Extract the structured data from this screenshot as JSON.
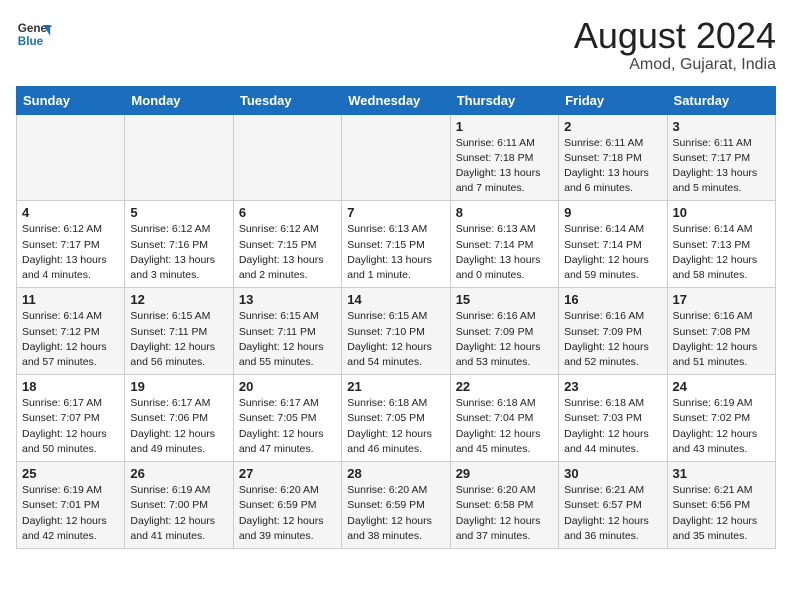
{
  "header": {
    "logo_line1": "General",
    "logo_line2": "Blue",
    "title": "August 2024",
    "subtitle": "Amod, Gujarat, India"
  },
  "days_of_week": [
    "Sunday",
    "Monday",
    "Tuesday",
    "Wednesday",
    "Thursday",
    "Friday",
    "Saturday"
  ],
  "weeks": [
    [
      {
        "num": "",
        "info": ""
      },
      {
        "num": "",
        "info": ""
      },
      {
        "num": "",
        "info": ""
      },
      {
        "num": "",
        "info": ""
      },
      {
        "num": "1",
        "info": "Sunrise: 6:11 AM\nSunset: 7:18 PM\nDaylight: 13 hours\nand 7 minutes."
      },
      {
        "num": "2",
        "info": "Sunrise: 6:11 AM\nSunset: 7:18 PM\nDaylight: 13 hours\nand 6 minutes."
      },
      {
        "num": "3",
        "info": "Sunrise: 6:11 AM\nSunset: 7:17 PM\nDaylight: 13 hours\nand 5 minutes."
      }
    ],
    [
      {
        "num": "4",
        "info": "Sunrise: 6:12 AM\nSunset: 7:17 PM\nDaylight: 13 hours\nand 4 minutes."
      },
      {
        "num": "5",
        "info": "Sunrise: 6:12 AM\nSunset: 7:16 PM\nDaylight: 13 hours\nand 3 minutes."
      },
      {
        "num": "6",
        "info": "Sunrise: 6:12 AM\nSunset: 7:15 PM\nDaylight: 13 hours\nand 2 minutes."
      },
      {
        "num": "7",
        "info": "Sunrise: 6:13 AM\nSunset: 7:15 PM\nDaylight: 13 hours\nand 1 minute."
      },
      {
        "num": "8",
        "info": "Sunrise: 6:13 AM\nSunset: 7:14 PM\nDaylight: 13 hours\nand 0 minutes."
      },
      {
        "num": "9",
        "info": "Sunrise: 6:14 AM\nSunset: 7:14 PM\nDaylight: 12 hours\nand 59 minutes."
      },
      {
        "num": "10",
        "info": "Sunrise: 6:14 AM\nSunset: 7:13 PM\nDaylight: 12 hours\nand 58 minutes."
      }
    ],
    [
      {
        "num": "11",
        "info": "Sunrise: 6:14 AM\nSunset: 7:12 PM\nDaylight: 12 hours\nand 57 minutes."
      },
      {
        "num": "12",
        "info": "Sunrise: 6:15 AM\nSunset: 7:11 PM\nDaylight: 12 hours\nand 56 minutes."
      },
      {
        "num": "13",
        "info": "Sunrise: 6:15 AM\nSunset: 7:11 PM\nDaylight: 12 hours\nand 55 minutes."
      },
      {
        "num": "14",
        "info": "Sunrise: 6:15 AM\nSunset: 7:10 PM\nDaylight: 12 hours\nand 54 minutes."
      },
      {
        "num": "15",
        "info": "Sunrise: 6:16 AM\nSunset: 7:09 PM\nDaylight: 12 hours\nand 53 minutes."
      },
      {
        "num": "16",
        "info": "Sunrise: 6:16 AM\nSunset: 7:09 PM\nDaylight: 12 hours\nand 52 minutes."
      },
      {
        "num": "17",
        "info": "Sunrise: 6:16 AM\nSunset: 7:08 PM\nDaylight: 12 hours\nand 51 minutes."
      }
    ],
    [
      {
        "num": "18",
        "info": "Sunrise: 6:17 AM\nSunset: 7:07 PM\nDaylight: 12 hours\nand 50 minutes."
      },
      {
        "num": "19",
        "info": "Sunrise: 6:17 AM\nSunset: 7:06 PM\nDaylight: 12 hours\nand 49 minutes."
      },
      {
        "num": "20",
        "info": "Sunrise: 6:17 AM\nSunset: 7:05 PM\nDaylight: 12 hours\nand 47 minutes."
      },
      {
        "num": "21",
        "info": "Sunrise: 6:18 AM\nSunset: 7:05 PM\nDaylight: 12 hours\nand 46 minutes."
      },
      {
        "num": "22",
        "info": "Sunrise: 6:18 AM\nSunset: 7:04 PM\nDaylight: 12 hours\nand 45 minutes."
      },
      {
        "num": "23",
        "info": "Sunrise: 6:18 AM\nSunset: 7:03 PM\nDaylight: 12 hours\nand 44 minutes."
      },
      {
        "num": "24",
        "info": "Sunrise: 6:19 AM\nSunset: 7:02 PM\nDaylight: 12 hours\nand 43 minutes."
      }
    ],
    [
      {
        "num": "25",
        "info": "Sunrise: 6:19 AM\nSunset: 7:01 PM\nDaylight: 12 hours\nand 42 minutes."
      },
      {
        "num": "26",
        "info": "Sunrise: 6:19 AM\nSunset: 7:00 PM\nDaylight: 12 hours\nand 41 minutes."
      },
      {
        "num": "27",
        "info": "Sunrise: 6:20 AM\nSunset: 6:59 PM\nDaylight: 12 hours\nand 39 minutes."
      },
      {
        "num": "28",
        "info": "Sunrise: 6:20 AM\nSunset: 6:59 PM\nDaylight: 12 hours\nand 38 minutes."
      },
      {
        "num": "29",
        "info": "Sunrise: 6:20 AM\nSunset: 6:58 PM\nDaylight: 12 hours\nand 37 minutes."
      },
      {
        "num": "30",
        "info": "Sunrise: 6:21 AM\nSunset: 6:57 PM\nDaylight: 12 hours\nand 36 minutes."
      },
      {
        "num": "31",
        "info": "Sunrise: 6:21 AM\nSunset: 6:56 PM\nDaylight: 12 hours\nand 35 minutes."
      }
    ]
  ]
}
